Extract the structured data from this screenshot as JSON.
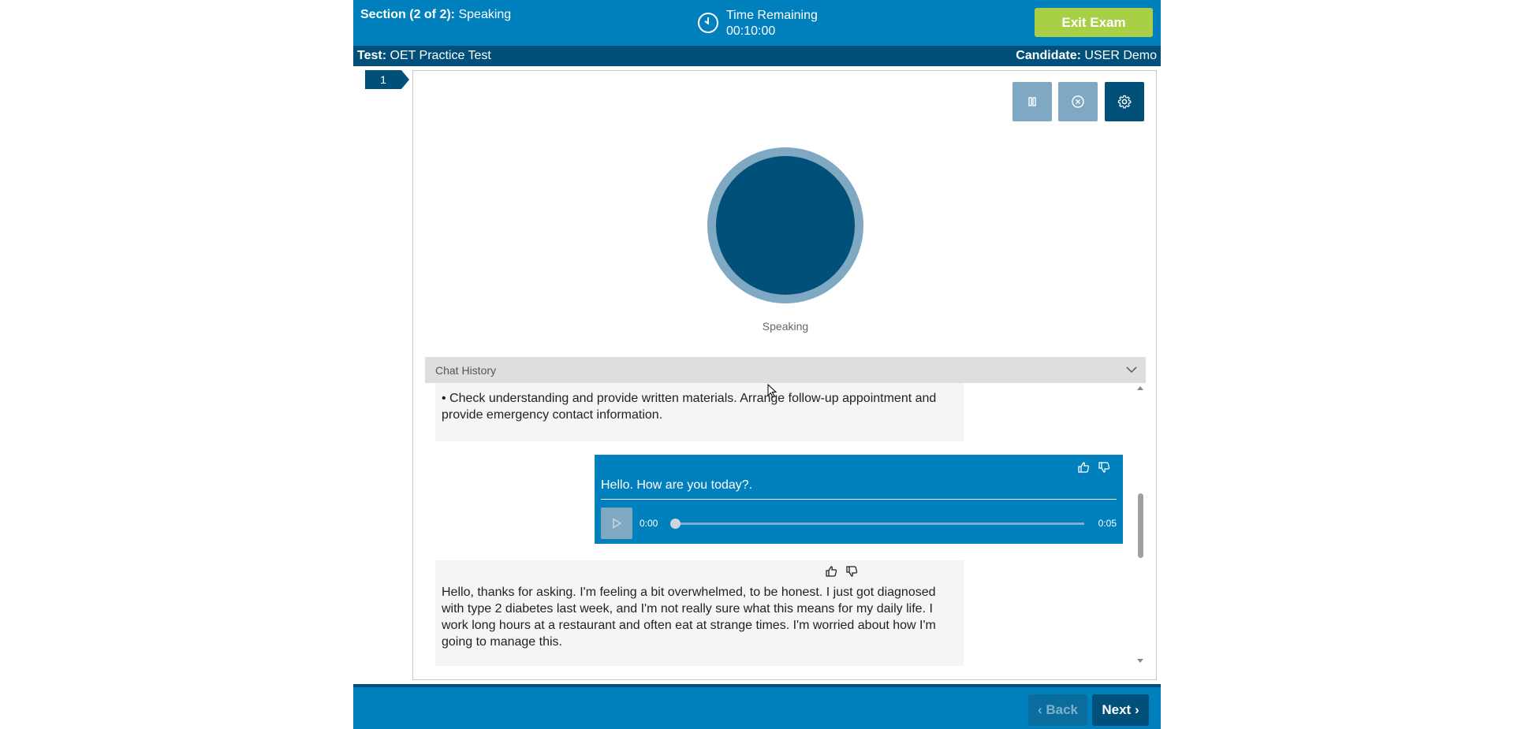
{
  "header": {
    "section_prefix": "Section (2 of 2):",
    "section_name": "Speaking",
    "timer_label": "Time Remaining",
    "timer_value": "00:10:00",
    "exit_label": "Exit Exam"
  },
  "subheader": {
    "test_label": "Test:",
    "test_name": "OET Practice Test",
    "candidate_label": "Candidate:",
    "candidate_name": "USER Demo"
  },
  "question_number": "1",
  "controls": {
    "icons": [
      "pause-icon",
      "stop-icon",
      "gear-icon"
    ]
  },
  "avatar": {
    "status_label": "Speaking"
  },
  "chat": {
    "header_label": "Chat History",
    "messages": [
      {
        "role": "assistant",
        "text": "• Check understanding and provide written materials. Arrange follow-up appointment and provide emergency contact information."
      },
      {
        "role": "user",
        "text": "Hello. How are you today?.",
        "audio": {
          "current_time": "0:00",
          "duration": "0:05",
          "progress": 0
        }
      },
      {
        "role": "assistant",
        "text": "Hello, thanks for asking. I'm feeling a bit overwhelmed, to be honest. I just got diagnosed with type 2 diabetes last week, and I'm not really sure what this means for my daily life. I work long hours at a restaurant and often eat at strange times. I'm worried about how I'm going to manage this."
      }
    ]
  },
  "footer": {
    "back_label": "Back",
    "next_label": "Next"
  },
  "colors": {
    "primary": "#0080bd",
    "dark": "#00507a",
    "muted": "#7fa8c2",
    "exit": "#a9cf46"
  }
}
